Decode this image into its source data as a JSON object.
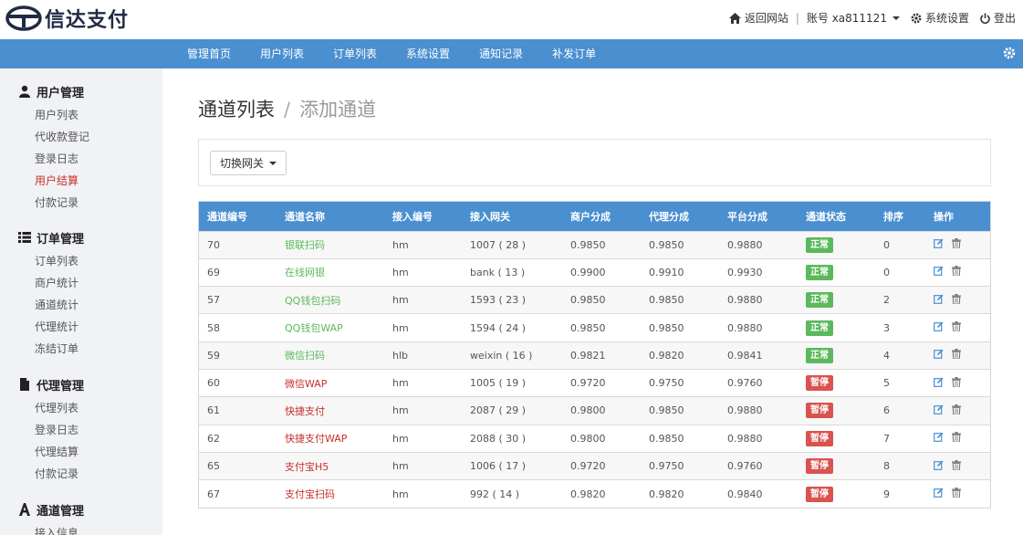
{
  "brand": {
    "name": "信达支付"
  },
  "header": {
    "home_link": "返回网站",
    "account_label": "账号 xa811121",
    "settings_label": "系统设置",
    "logout_label": "登出"
  },
  "nav": {
    "items": [
      "管理首页",
      "用户列表",
      "订单列表",
      "系统设置",
      "通知记录",
      "补发订单"
    ]
  },
  "sidebar": {
    "groups": [
      {
        "title": "用户管理",
        "icon": "user-icon",
        "items": [
          {
            "label": "用户列表"
          },
          {
            "label": "代收款登记"
          },
          {
            "label": "登录日志"
          },
          {
            "label": "用户结算",
            "active": true
          },
          {
            "label": "付款记录"
          }
        ]
      },
      {
        "title": "订单管理",
        "icon": "list-icon",
        "items": [
          {
            "label": "订单列表"
          },
          {
            "label": "商户统计"
          },
          {
            "label": "通道统计"
          },
          {
            "label": "代理统计"
          },
          {
            "label": "冻结订单"
          }
        ]
      },
      {
        "title": "代理管理",
        "icon": "file-icon",
        "items": [
          {
            "label": "代理列表"
          },
          {
            "label": "登录日志"
          },
          {
            "label": "代理结算"
          },
          {
            "label": "付款记录"
          }
        ]
      },
      {
        "title": "通道管理",
        "icon": "font-a-icon",
        "items": [
          {
            "label": "接入信息"
          }
        ]
      }
    ]
  },
  "page": {
    "title": "通道列表",
    "separator": "/",
    "subtitle": "添加通道",
    "gateway_button": "切换网关"
  },
  "table": {
    "columns": [
      "通道编号",
      "通道名称",
      "接入编号",
      "接入网关",
      "商户分成",
      "代理分成",
      "平台分成",
      "通道状态",
      "排序",
      "操作"
    ],
    "rows": [
      {
        "id": "70",
        "name": "银联扫码",
        "access_no": "hm",
        "gateway": "1007 ( 28 )",
        "merchant": "0.9850",
        "agent": "0.9850",
        "platform": "0.9880",
        "status": "正常",
        "ok": true,
        "sort": "0"
      },
      {
        "id": "69",
        "name": "在线网银",
        "access_no": "hm",
        "gateway": "bank ( 13 )",
        "merchant": "0.9900",
        "agent": "0.9910",
        "platform": "0.9930",
        "status": "正常",
        "ok": true,
        "sort": "0"
      },
      {
        "id": "57",
        "name": "QQ钱包扫码",
        "access_no": "hm",
        "gateway": "1593 ( 23 )",
        "merchant": "0.9850",
        "agent": "0.9850",
        "platform": "0.9880",
        "status": "正常",
        "ok": true,
        "sort": "2"
      },
      {
        "id": "58",
        "name": "QQ钱包WAP",
        "access_no": "hm",
        "gateway": "1594 ( 24 )",
        "merchant": "0.9850",
        "agent": "0.9850",
        "platform": "0.9880",
        "status": "正常",
        "ok": true,
        "sort": "3"
      },
      {
        "id": "59",
        "name": "微信扫码",
        "access_no": "hlb",
        "gateway": "weixin ( 16 )",
        "merchant": "0.9821",
        "agent": "0.9820",
        "platform": "0.9841",
        "status": "正常",
        "ok": true,
        "sort": "4"
      },
      {
        "id": "60",
        "name": "微信WAP",
        "access_no": "hm",
        "gateway": "1005 ( 19 )",
        "merchant": "0.9720",
        "agent": "0.9750",
        "platform": "0.9760",
        "status": "暂停",
        "ok": false,
        "sort": "5"
      },
      {
        "id": "61",
        "name": "快捷支付",
        "access_no": "hm",
        "gateway": "2087 ( 29 )",
        "merchant": "0.9800",
        "agent": "0.9850",
        "platform": "0.9880",
        "status": "暂停",
        "ok": false,
        "sort": "6"
      },
      {
        "id": "62",
        "name": "快捷支付WAP",
        "access_no": "hm",
        "gateway": "2088 ( 30 )",
        "merchant": "0.9800",
        "agent": "0.9850",
        "platform": "0.9880",
        "status": "暂停",
        "ok": false,
        "sort": "7"
      },
      {
        "id": "65",
        "name": "支付宝H5",
        "access_no": "hm",
        "gateway": "1006 ( 17 )",
        "merchant": "0.9720",
        "agent": "0.9750",
        "platform": "0.9760",
        "status": "暂停",
        "ok": false,
        "sort": "8"
      },
      {
        "id": "67",
        "name": "支付宝扫码",
        "access_no": "hm",
        "gateway": "992 ( 14 )",
        "merchant": "0.9820",
        "agent": "0.9820",
        "platform": "0.9840",
        "status": "暂停",
        "ok": false,
        "sort": "9"
      }
    ]
  },
  "colors": {
    "accent": "#4a8fd0",
    "ok": "#5cb85c",
    "bad": "#d9534f",
    "active_link": "#c9302c"
  }
}
